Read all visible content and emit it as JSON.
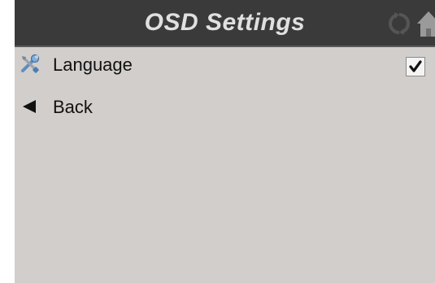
{
  "header": {
    "title": "OSD Settings",
    "refresh_icon": "refresh-icon",
    "home_icon": "home-icon"
  },
  "menu": {
    "items": [
      {
        "label": "Language",
        "icon": "tools-icon",
        "checked": true
      },
      {
        "label": "Back",
        "icon": "back-arrow-icon"
      }
    ]
  },
  "colors": {
    "header_bg": "#3a3a3a",
    "body_bg": "#d2cecb",
    "title_text": "#e0e0e0"
  }
}
